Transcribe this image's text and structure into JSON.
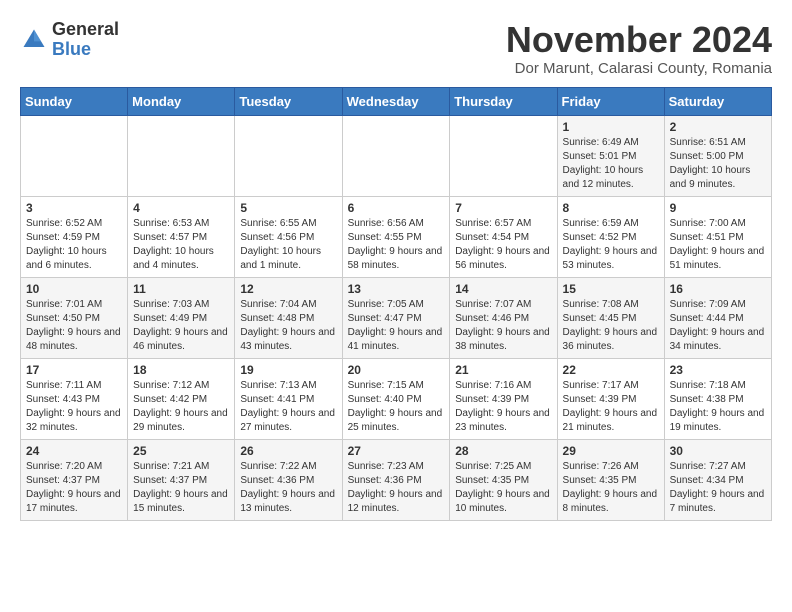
{
  "header": {
    "logo_general": "General",
    "logo_blue": "Blue",
    "month_title": "November 2024",
    "subtitle": "Dor Marunt, Calarasi County, Romania"
  },
  "days_of_week": [
    "Sunday",
    "Monday",
    "Tuesday",
    "Wednesday",
    "Thursday",
    "Friday",
    "Saturday"
  ],
  "weeks": [
    [
      {
        "day": "",
        "info": ""
      },
      {
        "day": "",
        "info": ""
      },
      {
        "day": "",
        "info": ""
      },
      {
        "day": "",
        "info": ""
      },
      {
        "day": "",
        "info": ""
      },
      {
        "day": "1",
        "info": "Sunrise: 6:49 AM\nSunset: 5:01 PM\nDaylight: 10 hours and 12 minutes."
      },
      {
        "day": "2",
        "info": "Sunrise: 6:51 AM\nSunset: 5:00 PM\nDaylight: 10 hours and 9 minutes."
      }
    ],
    [
      {
        "day": "3",
        "info": "Sunrise: 6:52 AM\nSunset: 4:59 PM\nDaylight: 10 hours and 6 minutes."
      },
      {
        "day": "4",
        "info": "Sunrise: 6:53 AM\nSunset: 4:57 PM\nDaylight: 10 hours and 4 minutes."
      },
      {
        "day": "5",
        "info": "Sunrise: 6:55 AM\nSunset: 4:56 PM\nDaylight: 10 hours and 1 minute."
      },
      {
        "day": "6",
        "info": "Sunrise: 6:56 AM\nSunset: 4:55 PM\nDaylight: 9 hours and 58 minutes."
      },
      {
        "day": "7",
        "info": "Sunrise: 6:57 AM\nSunset: 4:54 PM\nDaylight: 9 hours and 56 minutes."
      },
      {
        "day": "8",
        "info": "Sunrise: 6:59 AM\nSunset: 4:52 PM\nDaylight: 9 hours and 53 minutes."
      },
      {
        "day": "9",
        "info": "Sunrise: 7:00 AM\nSunset: 4:51 PM\nDaylight: 9 hours and 51 minutes."
      }
    ],
    [
      {
        "day": "10",
        "info": "Sunrise: 7:01 AM\nSunset: 4:50 PM\nDaylight: 9 hours and 48 minutes."
      },
      {
        "day": "11",
        "info": "Sunrise: 7:03 AM\nSunset: 4:49 PM\nDaylight: 9 hours and 46 minutes."
      },
      {
        "day": "12",
        "info": "Sunrise: 7:04 AM\nSunset: 4:48 PM\nDaylight: 9 hours and 43 minutes."
      },
      {
        "day": "13",
        "info": "Sunrise: 7:05 AM\nSunset: 4:47 PM\nDaylight: 9 hours and 41 minutes."
      },
      {
        "day": "14",
        "info": "Sunrise: 7:07 AM\nSunset: 4:46 PM\nDaylight: 9 hours and 38 minutes."
      },
      {
        "day": "15",
        "info": "Sunrise: 7:08 AM\nSunset: 4:45 PM\nDaylight: 9 hours and 36 minutes."
      },
      {
        "day": "16",
        "info": "Sunrise: 7:09 AM\nSunset: 4:44 PM\nDaylight: 9 hours and 34 minutes."
      }
    ],
    [
      {
        "day": "17",
        "info": "Sunrise: 7:11 AM\nSunset: 4:43 PM\nDaylight: 9 hours and 32 minutes."
      },
      {
        "day": "18",
        "info": "Sunrise: 7:12 AM\nSunset: 4:42 PM\nDaylight: 9 hours and 29 minutes."
      },
      {
        "day": "19",
        "info": "Sunrise: 7:13 AM\nSunset: 4:41 PM\nDaylight: 9 hours and 27 minutes."
      },
      {
        "day": "20",
        "info": "Sunrise: 7:15 AM\nSunset: 4:40 PM\nDaylight: 9 hours and 25 minutes."
      },
      {
        "day": "21",
        "info": "Sunrise: 7:16 AM\nSunset: 4:39 PM\nDaylight: 9 hours and 23 minutes."
      },
      {
        "day": "22",
        "info": "Sunrise: 7:17 AM\nSunset: 4:39 PM\nDaylight: 9 hours and 21 minutes."
      },
      {
        "day": "23",
        "info": "Sunrise: 7:18 AM\nSunset: 4:38 PM\nDaylight: 9 hours and 19 minutes."
      }
    ],
    [
      {
        "day": "24",
        "info": "Sunrise: 7:20 AM\nSunset: 4:37 PM\nDaylight: 9 hours and 17 minutes."
      },
      {
        "day": "25",
        "info": "Sunrise: 7:21 AM\nSunset: 4:37 PM\nDaylight: 9 hours and 15 minutes."
      },
      {
        "day": "26",
        "info": "Sunrise: 7:22 AM\nSunset: 4:36 PM\nDaylight: 9 hours and 13 minutes."
      },
      {
        "day": "27",
        "info": "Sunrise: 7:23 AM\nSunset: 4:36 PM\nDaylight: 9 hours and 12 minutes."
      },
      {
        "day": "28",
        "info": "Sunrise: 7:25 AM\nSunset: 4:35 PM\nDaylight: 9 hours and 10 minutes."
      },
      {
        "day": "29",
        "info": "Sunrise: 7:26 AM\nSunset: 4:35 PM\nDaylight: 9 hours and 8 minutes."
      },
      {
        "day": "30",
        "info": "Sunrise: 7:27 AM\nSunset: 4:34 PM\nDaylight: 9 hours and 7 minutes."
      }
    ]
  ]
}
